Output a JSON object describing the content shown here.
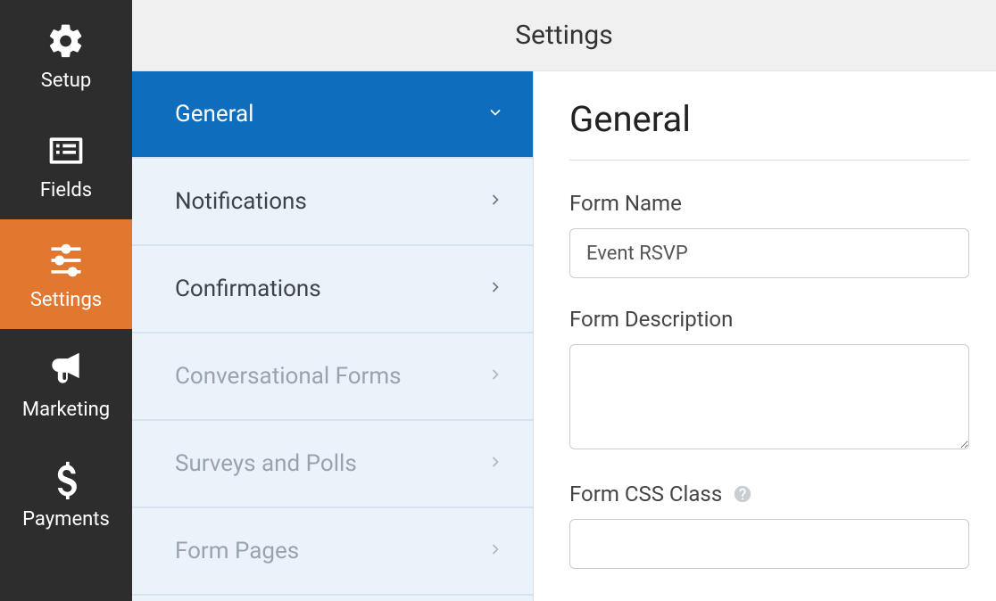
{
  "header": {
    "title": "Settings"
  },
  "nav": {
    "items": [
      {
        "label": "Setup",
        "icon": "gear-icon",
        "active": false
      },
      {
        "label": "Fields",
        "icon": "list-icon",
        "active": false
      },
      {
        "label": "Settings",
        "icon": "sliders-icon",
        "active": true
      },
      {
        "label": "Marketing",
        "icon": "bullhorn-icon",
        "active": false
      },
      {
        "label": "Payments",
        "icon": "dollar-icon",
        "active": false
      }
    ]
  },
  "settings_menu": {
    "items": [
      {
        "label": "General",
        "active": true,
        "muted": false,
        "chevron": "down"
      },
      {
        "label": "Notifications",
        "active": false,
        "muted": false,
        "chevron": "right"
      },
      {
        "label": "Confirmations",
        "active": false,
        "muted": false,
        "chevron": "right"
      },
      {
        "label": "Conversational Forms",
        "active": false,
        "muted": true,
        "chevron": "right"
      },
      {
        "label": "Surveys and Polls",
        "active": false,
        "muted": true,
        "chevron": "right"
      },
      {
        "label": "Form Pages",
        "active": false,
        "muted": true,
        "chevron": "right"
      }
    ]
  },
  "form": {
    "title": "General",
    "form_name_label": "Form Name",
    "form_name_value": "Event RSVP",
    "form_description_label": "Form Description",
    "form_description_value": "",
    "form_css_class_label": "Form CSS Class",
    "form_css_class_value": ""
  }
}
